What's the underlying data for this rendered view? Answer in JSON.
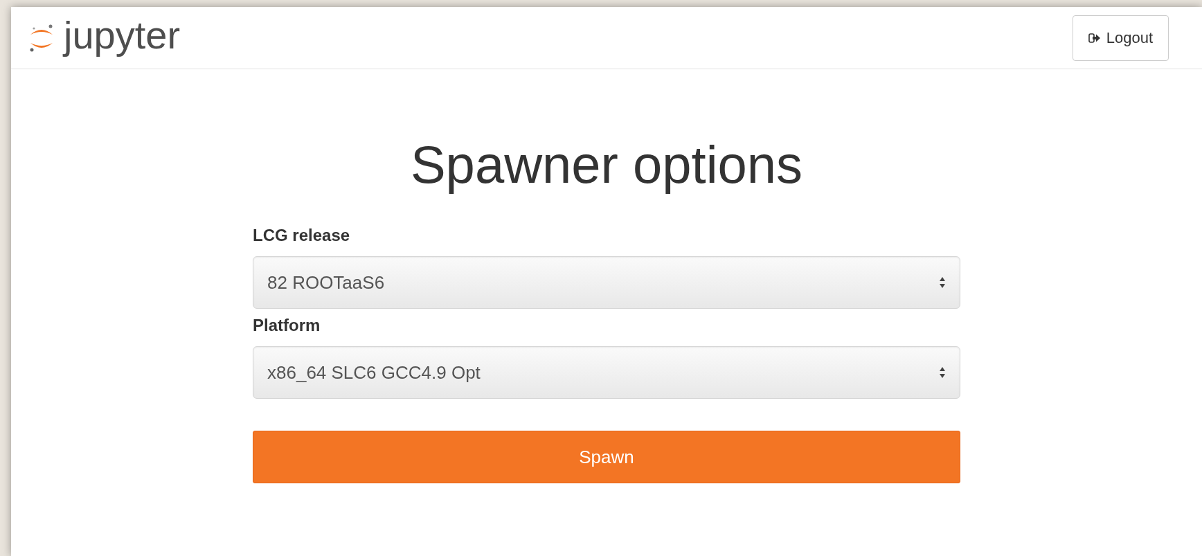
{
  "header": {
    "logo_text": "jupyter",
    "logout_button": "Logout"
  },
  "title": "Spawner options",
  "fields": [
    {
      "label": "LCG release",
      "value": "82 ROOTaaS6"
    },
    {
      "label": "Platform",
      "value": "x86_64 SLC6 GCC4.9 Opt"
    }
  ],
  "submit_button": "Spawn"
}
